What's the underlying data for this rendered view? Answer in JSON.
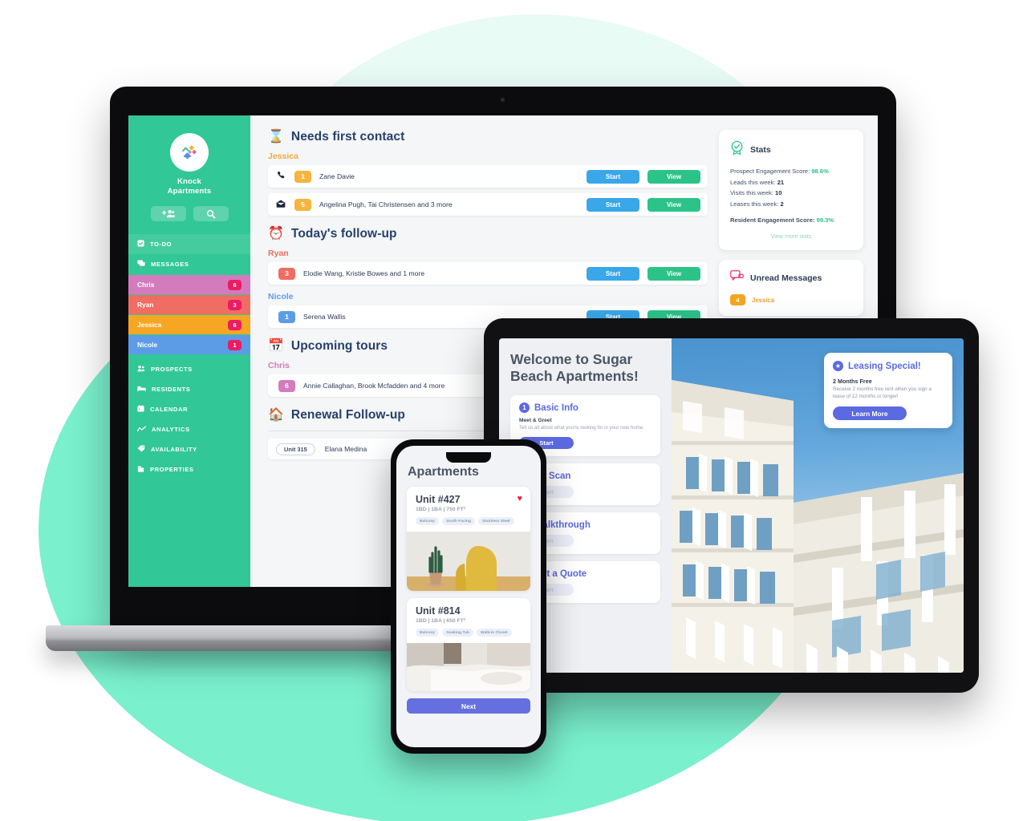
{
  "background": {
    "blob_light": "#e8fbf5",
    "blob_mint": "#7af0cd"
  },
  "laptop": {
    "sidebar": {
      "brand": {
        "name": "Knock\nApartments",
        "line1": "Knock",
        "line2": "Apartments"
      },
      "actions": [
        {
          "name": "add-contact-button",
          "icon": "add-people-icon"
        },
        {
          "name": "search-button",
          "icon": "search-icon"
        }
      ],
      "nav": [
        {
          "label": "TO-DO",
          "icon": "checkbox-icon"
        },
        {
          "label": "MESSAGES",
          "icon": "chat-icon"
        }
      ],
      "people": [
        {
          "label": "Chris",
          "badge": "6",
          "color": "#d37bbd"
        },
        {
          "label": "Ryan",
          "badge": "3",
          "color": "#ef6d62"
        },
        {
          "label": "Jessica",
          "badge": "6",
          "color": "#f5a623"
        },
        {
          "label": "Nicole",
          "badge": "1",
          "color": "#5c9ce6"
        }
      ],
      "nav2": [
        {
          "label": "PROSPECTS",
          "icon": "people-icon"
        },
        {
          "label": "RESIDENTS",
          "icon": "bed-icon"
        },
        {
          "label": "CALENDAR",
          "icon": "calendar-icon"
        },
        {
          "label": "ANALYTICS",
          "icon": "chart-line-icon"
        },
        {
          "label": "AVAILABILITY",
          "icon": "tag-icon"
        },
        {
          "label": "PROPERTIES",
          "icon": "building-icon"
        }
      ]
    },
    "sections": [
      {
        "emoji": "⌛",
        "title": "Needs first contact",
        "groups": [
          {
            "owner": "Jessica",
            "owner_color": "#f0a93c",
            "rows": [
              {
                "icon": "phone-icon",
                "count": "1",
                "count_color": "#f5b53f",
                "name": "Zane Davie",
                "start": "Start",
                "view": "View"
              },
              {
                "icon": "envelope-icon",
                "count": "5",
                "count_color": "#f5b53f",
                "name": "Angelina Pugh, Tai Christensen and 3 more",
                "start": "Start",
                "view": "View"
              }
            ]
          }
        ]
      },
      {
        "emoji": "⏰",
        "title": "Today's follow-up",
        "groups": [
          {
            "owner": "Ryan",
            "owner_color": "#ef6d62",
            "rows": [
              {
                "icon": "",
                "count": "3",
                "count_color": "#ef6d62",
                "name": "Elodie Wang, Kristie Bowes and 1 more",
                "start": "Start",
                "view": "View"
              }
            ]
          },
          {
            "owner": "Nicole",
            "owner_color": "#5c9ce6",
            "rows": [
              {
                "icon": "",
                "count": "1",
                "count_color": "#5c9ce6",
                "name": "Serena Wallis",
                "start": "Start",
                "view": "View"
              }
            ]
          }
        ]
      },
      {
        "emoji": "📅",
        "title": "Upcoming tours",
        "groups": [
          {
            "owner": "Chris",
            "owner_color": "#d37bbd",
            "rows": [
              {
                "icon": "",
                "count": "6",
                "count_color": "#d37bbd",
                "name": "Annie Callaghan, Brook Mcfadden and 4 more",
                "start": "Start",
                "view": "View"
              }
            ]
          }
        ]
      },
      {
        "emoji": "🏠",
        "title": "Renewal Follow-up",
        "groups": []
      }
    ],
    "renewal_row": {
      "unit": "Unit 315",
      "name": "Elana Medina"
    },
    "rail": {
      "stats_card": {
        "icon": "badge-check-icon",
        "title": "Stats",
        "lines": [
          {
            "label": "Prospect Engagement Score:",
            "value": "98.6%",
            "highlight": true
          },
          {
            "label": "Leads this week:",
            "value": "21",
            "highlight": false
          },
          {
            "label": "Visits this week:",
            "value": "10",
            "highlight": false
          },
          {
            "label": "Leases this week:",
            "value": "2",
            "highlight": false
          }
        ],
        "resident": {
          "label": "Resident Engagement Score:",
          "value": "99.3%"
        },
        "view_more": "View more stats"
      },
      "messages_card": {
        "icon": "chat-bubble-icon",
        "title": "Unread Messages",
        "rows": [
          {
            "count": "4",
            "name": "Jessica"
          }
        ]
      }
    }
  },
  "tablet": {
    "title": "Welcome to Sugar Beach Apartments!",
    "steps": [
      {
        "num": "1",
        "title": "Basic Info",
        "sub": "Meet & Greet",
        "desc": "Tell us all about what you're looking for in your new home.",
        "button": "Start",
        "active": true
      },
      {
        "num": "2",
        "title": "3D Scan",
        "sub": "",
        "desc": "",
        "button": "Start",
        "active": false
      },
      {
        "num": "3",
        "title": "Walkthrough",
        "sub": "",
        "desc": "",
        "button": "Start",
        "active": false
      },
      {
        "num": "4",
        "title": "Get a Quote",
        "sub": "",
        "desc": "",
        "button": "Start",
        "active": false
      }
    ],
    "special": {
      "icon": "star-badge-icon",
      "title": "Leasing Special!",
      "subtitle": "2 Months Free",
      "description": "Receive 2 months free rent when you sign a lease of 12 months or longer!",
      "button": "Learn More"
    }
  },
  "phone": {
    "header": "Apartments",
    "units": [
      {
        "title": "Unit #427",
        "meta": "1BD | 1BA | 750 FT²",
        "tags": [
          "Balcony",
          "South Facing",
          "Stainless Steel"
        ],
        "favorite": true,
        "photo": "living-room-yellow-chair"
      },
      {
        "title": "Unit #814",
        "meta": "1BD | 1BA | 650 FT²",
        "tags": [
          "Balcony",
          "Soaking Tub",
          "Walk-in Closet"
        ],
        "favorite": false,
        "photo": "bedroom-white-linens"
      }
    ],
    "next_button": "Next"
  }
}
